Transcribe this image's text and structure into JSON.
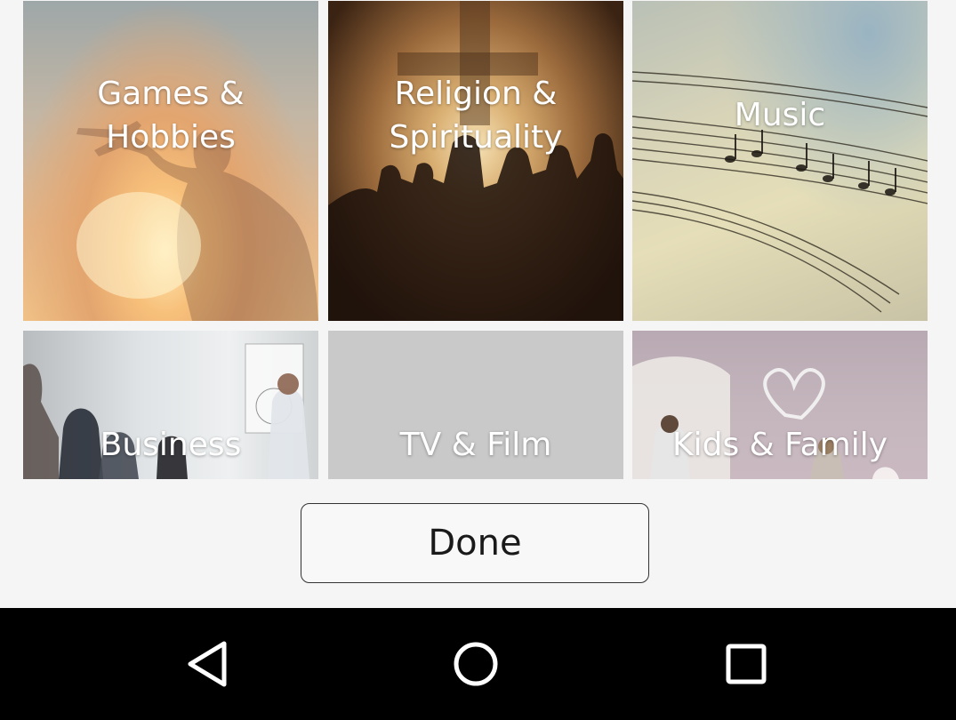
{
  "categories": [
    {
      "id": "games",
      "label_lines": [
        "Games &",
        "Hobbies"
      ]
    },
    {
      "id": "religion",
      "label_lines": [
        "Religion &",
        "Spirituality"
      ]
    },
    {
      "id": "music",
      "label_lines": [
        "Music"
      ]
    },
    {
      "id": "business",
      "label_lines": [
        "Business"
      ]
    },
    {
      "id": "tv",
      "label_lines": [
        "TV & Film"
      ]
    },
    {
      "id": "kids",
      "label_lines": [
        "Kids & Family"
      ]
    }
  ],
  "done_button": {
    "label": "Done"
  },
  "nav_bar": {
    "back_icon": "back-triangle-icon",
    "home_icon": "home-circle-icon",
    "recents_icon": "recents-square-icon",
    "color": "#ffffff"
  },
  "colors": {
    "background": "#f4f5f4",
    "nav_background": "#000000",
    "label_text": "#ffffff"
  }
}
